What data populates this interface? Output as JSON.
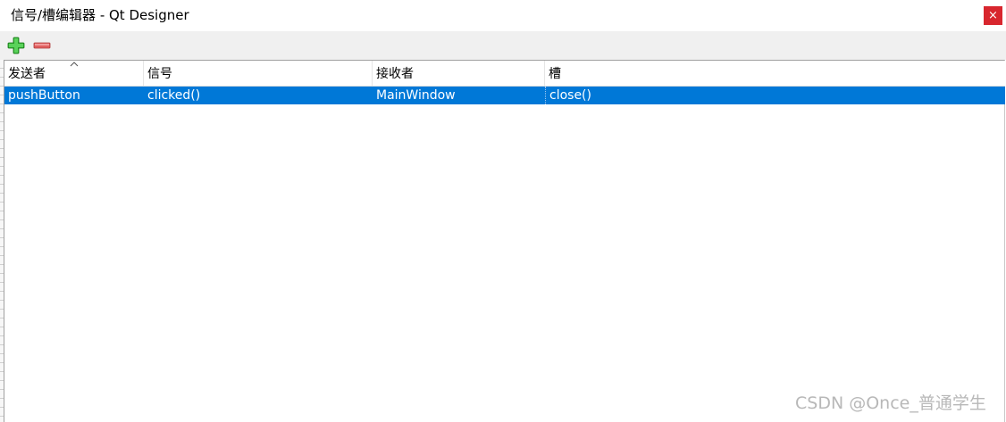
{
  "window": {
    "title": "信号/槽编辑器 - Qt Designer",
    "close_glyph": "×"
  },
  "toolbar": {
    "add_icon": "plus-icon",
    "remove_icon": "minus-icon",
    "add_color": "#3cb83c",
    "remove_color": "#e05a5a"
  },
  "table": {
    "columns": [
      "发送者",
      "信号",
      "接收者",
      "槽"
    ],
    "sorted_column": "发送者",
    "rows": [
      {
        "sender": "pushButton",
        "signal": "clicked()",
        "receiver": "MainWindow",
        "slot": "close()"
      }
    ],
    "selected_row_color": "#0078d7"
  },
  "watermark": "CSDN @Once_普通学生"
}
